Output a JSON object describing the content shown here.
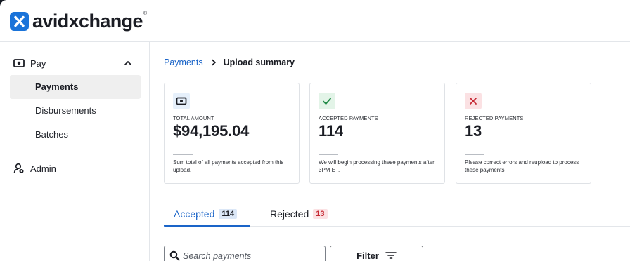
{
  "brand": {
    "name": "avidxchange",
    "registered": "®",
    "color": "#1a73d9"
  },
  "sidebar": {
    "sections": [
      {
        "label": "Pay",
        "icon": "money-icon",
        "expanded": true,
        "items": [
          {
            "label": "Payments",
            "active": true
          },
          {
            "label": "Disbursements",
            "active": false
          },
          {
            "label": "Batches",
            "active": false
          }
        ]
      },
      {
        "label": "Admin",
        "icon": "admin-user-icon",
        "expanded": false,
        "items": []
      }
    ]
  },
  "breadcrumb": {
    "parent": "Payments",
    "current": "Upload summary"
  },
  "cards": [
    {
      "icon": "money-icon",
      "caption": "TOTAL AMOUNT",
      "value": "$94,195.04",
      "note": "Sum total of all payments accepted from this upload."
    },
    {
      "icon": "checkmark-icon",
      "caption": "ACCEPTED PAYMENTS",
      "value": "114",
      "note": "We will begin processing these payments after 3PM ET."
    },
    {
      "icon": "x-mark-icon",
      "caption": "REJECTED PAYMENTS",
      "value": "13",
      "note": "Please correct errors and reupload to process these payments"
    }
  ],
  "tabs": [
    {
      "label": "Accepted",
      "count": "114",
      "active": true
    },
    {
      "label": "Rejected",
      "count": "13",
      "active": false
    }
  ],
  "search": {
    "placeholder": "Search payments",
    "value": ""
  },
  "filter": {
    "label": "Filter"
  },
  "colors": {
    "link": "#1a64c8",
    "accepted_badge_bg": "#e3f4e8",
    "accepted_icon": "#218a47",
    "rejected_badge_bg": "#fbe1e3",
    "rejected_icon": "#c62833",
    "total_badge_bg": "#e6f0fb"
  }
}
